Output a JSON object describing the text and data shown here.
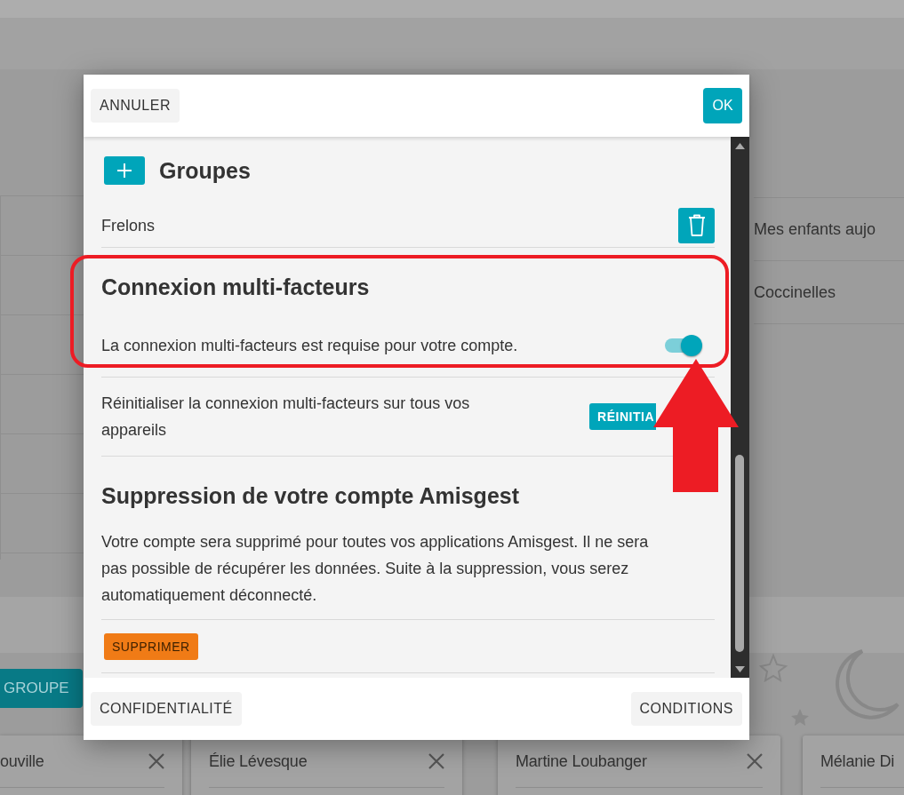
{
  "background": {
    "list_items": [
      "Mes enfants aujo",
      "Coccinelles"
    ],
    "group_button": "GROUPE",
    "cards": [
      {
        "name": "ouville"
      },
      {
        "name": "Élie Lévesque"
      },
      {
        "name": "Martine Loubanger"
      },
      {
        "name": "Mélanie Di"
      }
    ]
  },
  "dialog": {
    "cancel_button": "ANNULER",
    "ok_button": "OK",
    "groups": {
      "title": "Groupes",
      "items": [
        "Frelons"
      ]
    },
    "mfa": {
      "title": "Connexion multi-facteurs",
      "required_text": "La connexion multi-facteurs est requise pour votre compte.",
      "on": true,
      "reset_text": "Réinitialiser la connexion multi-facteurs sur tous vos appareils",
      "reset_button": "RÉINITIA"
    },
    "delete_account": {
      "title": "Suppression de votre compte Amisgest",
      "text": "Votre compte sera supprimé pour toutes vos applications Amisgest. Il ne sera pas possible de récupérer les données. Suite à la suppression, vous serez automatiquement déconnecté.",
      "button": "SUPPRIMER"
    },
    "footer_buttons": [
      "CONFIDENTIALITÉ",
      "CONDITIONS"
    ]
  }
}
